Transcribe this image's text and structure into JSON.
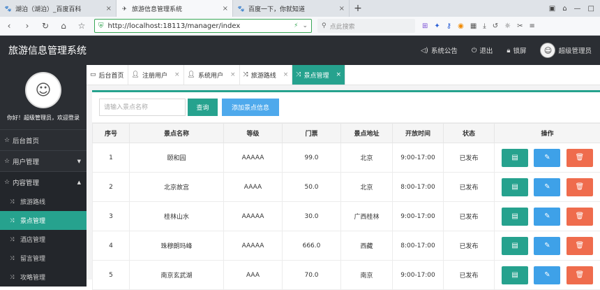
{
  "browser": {
    "tabs": [
      {
        "title": "湖泊（湖泊）_百度百科",
        "icon": "baidu-paw-icon",
        "active": false
      },
      {
        "title": "旅游信息管理系统",
        "icon": "app-logo-icon",
        "active": true
      },
      {
        "title": "百度一下，你就知道",
        "icon": "baidu-paw-icon",
        "active": false
      }
    ],
    "new_tab": "+",
    "url": "http://localhost:18113/manager/index",
    "search_placeholder": "点此搜索"
  },
  "header": {
    "title": "旅游信息管理系统",
    "notice": "系统公告",
    "logout": "退出",
    "lock": "锁屏",
    "user": "超级管理员"
  },
  "sidebar": {
    "welcome": "你好！超级管理员，欢迎登录",
    "items": [
      {
        "label": "后台首页",
        "icon": "star-icon"
      },
      {
        "label": "用户管理",
        "icon": "star-icon",
        "arrow": "▼"
      },
      {
        "label": "内容管理",
        "icon": "star-icon",
        "arrow": "▲"
      }
    ],
    "subitems": [
      {
        "label": "旅游路线",
        "icon": "route-icon"
      },
      {
        "label": "景点管理",
        "icon": "route-icon"
      },
      {
        "label": "酒店管理",
        "icon": "route-icon"
      },
      {
        "label": "留言管理",
        "icon": "route-icon"
      },
      {
        "label": "攻略管理",
        "icon": "route-icon"
      }
    ]
  },
  "content_tabs": [
    {
      "label": "后台首页",
      "icon": "monitor-icon",
      "closable": false
    },
    {
      "label": "注册用户",
      "icon": "user-icon",
      "closable": true
    },
    {
      "label": "系统用户",
      "icon": "user-icon",
      "closable": true
    },
    {
      "label": "旅游路线",
      "icon": "route-icon",
      "closable": true
    },
    {
      "label": "景点管理",
      "icon": "route-icon",
      "closable": true,
      "active": true
    }
  ],
  "toolbar": {
    "search_placeholder": "请输入景点名称",
    "query_label": "查询",
    "add_label": "添加景点信息"
  },
  "table": {
    "headers": [
      "序号",
      "景点名称",
      "等级",
      "门票",
      "景点地址",
      "开放时间",
      "状态",
      "操作"
    ],
    "rows": [
      [
        "1",
        "颐和园",
        "AAAAA",
        "99.0",
        "北京",
        "9:00-17:00",
        "已发布"
      ],
      [
        "2",
        "北京故宫",
        "AAAA",
        "50.0",
        "北京",
        "8:00-17:00",
        "已发布"
      ],
      [
        "3",
        "桂林山水",
        "AAAAA",
        "30.0",
        "广西桂林",
        "9:00-17:00",
        "已发布"
      ],
      [
        "4",
        "珠穆朗玛峰",
        "AAAAA",
        "666.0",
        "西藏",
        "8:00-17:00",
        "已发布"
      ],
      [
        "5",
        "南京玄武湖",
        "AAA",
        "70.0",
        "南京",
        "9:00-17:00",
        "已发布"
      ]
    ]
  },
  "colors": {
    "accent": "#26a28e",
    "blue": "#3ea1e8",
    "danger": "#ef6c4d",
    "dark": "#2b2e33"
  }
}
